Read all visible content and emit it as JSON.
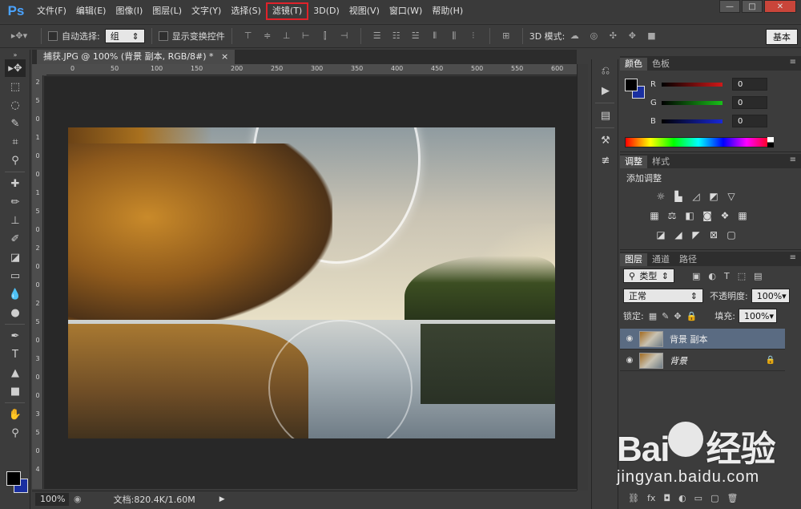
{
  "app": {
    "logo": "Ps"
  },
  "menu": {
    "items": [
      "文件(F)",
      "编辑(E)",
      "图像(I)",
      "图层(L)",
      "文字(Y)",
      "选择(S)",
      "滤镜(T)",
      "3D(D)",
      "视图(V)",
      "窗口(W)",
      "帮助(H)"
    ],
    "highlighted": "滤镜(T)"
  },
  "window_controls": {
    "minimize": "—",
    "maximize": "□",
    "close": "✕"
  },
  "options": {
    "auto_select_label": "自动选择:",
    "auto_select_value": "组",
    "show_transform_label": "显示变换控件",
    "mode_3d_label": "3D 模式:",
    "workspace": "基本"
  },
  "document": {
    "tab_title": "捕获.JPG @ 100% (背景 副本, RGB/8#) *",
    "close": "×",
    "ruler_h_ticks": [
      "0",
      "50",
      "100",
      "150",
      "200",
      "250",
      "300",
      "350",
      "400",
      "450",
      "500",
      "550",
      "600"
    ],
    "ruler_v_ticks": [
      "2",
      "5",
      "0",
      "1",
      "0",
      "0",
      "1",
      "5",
      "0",
      "2",
      "0",
      "0",
      "2",
      "5",
      "0",
      "3",
      "0",
      "0",
      "3",
      "5",
      "0",
      "4"
    ]
  },
  "status": {
    "zoom": "100%",
    "doc_size": "文档:820.4K/1.60M",
    "arrow": "▶"
  },
  "color_panel": {
    "tabs": [
      "颜色",
      "色板"
    ],
    "channels": [
      {
        "label": "R",
        "value": "0",
        "color": "#c82020"
      },
      {
        "label": "G",
        "value": "0",
        "color": "#20a820"
      },
      {
        "label": "B",
        "value": "0",
        "color": "#2030c8"
      }
    ],
    "foreground": "#000000",
    "background": "#1a2fa0"
  },
  "adjust_panel": {
    "tabs": [
      "调整",
      "样式"
    ],
    "title": "添加调整"
  },
  "layers_panel": {
    "tabs": [
      "图层",
      "通道",
      "路径"
    ],
    "filter_label": "类型",
    "blend_mode": "正常",
    "opacity_label": "不透明度:",
    "opacity_value": "100%",
    "lock_label": "锁定:",
    "fill_label": "填充:",
    "fill_value": "100%",
    "layers": [
      {
        "name": "背景 副本",
        "selected": true,
        "italic": false,
        "locked": false
      },
      {
        "name": "背景",
        "selected": false,
        "italic": true,
        "locked": true
      }
    ]
  },
  "watermark": {
    "logo_text": "Bai",
    "logo_text2": "经验",
    "url": "jingyan.baidu.com"
  }
}
